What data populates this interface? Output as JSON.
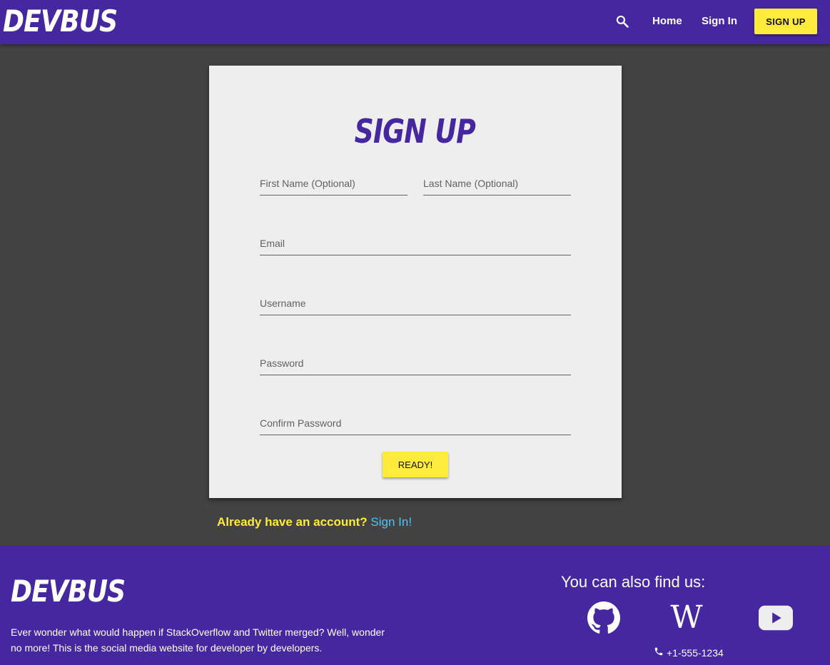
{
  "nav": {
    "brand": "DEVBUS",
    "search_icon": "search-icon",
    "home": "Home",
    "sign_in": "Sign In",
    "sign_up": "SIGN UP"
  },
  "form": {
    "title": "SIGN UP",
    "first_name_placeholder": "First Name (Optional)",
    "last_name_placeholder": "Last Name (Optional)",
    "email_placeholder": "Email",
    "username_placeholder": "Username",
    "password_placeholder": "Password",
    "confirm_password_placeholder": "Confirm Password",
    "submit": "READY!"
  },
  "already": {
    "question": "Already have an account?",
    "link": "Sign In!"
  },
  "footer": {
    "brand": "DEVBUS",
    "description": "Ever wonder what would happen if StackOverflow and Twitter merged? Well, wonder no more! This is the social media website for developer by developers.",
    "find_us": "You can also find us:",
    "social_icons": [
      "github-icon",
      "wikipedia-icon",
      "youtube-icon"
    ],
    "phone": "+1-555-1234"
  },
  "colors": {
    "primary": "#4527a0",
    "accent": "#ffeb3b",
    "background": "#424242",
    "card": "#eeeeee",
    "link": "#4fc3f7"
  }
}
